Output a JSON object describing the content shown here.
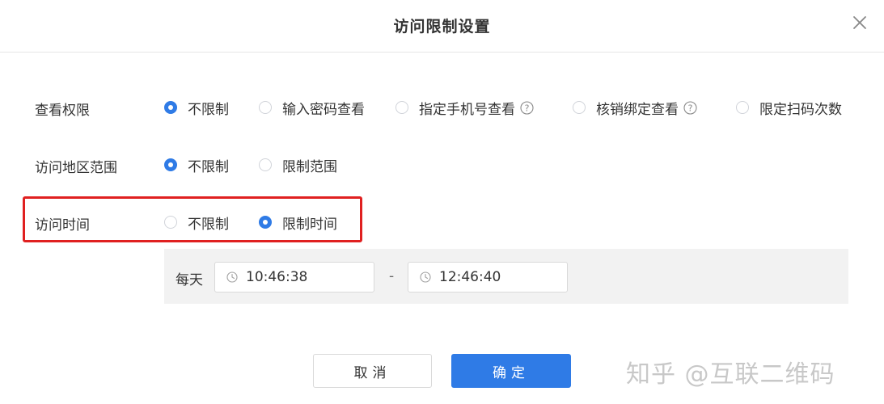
{
  "dialog": {
    "title": "访问限制设置"
  },
  "view_permission": {
    "label": "查看权限",
    "options": [
      {
        "label": "不限制",
        "checked": true
      },
      {
        "label": "输入密码查看",
        "checked": false
      },
      {
        "label": "指定手机号查看",
        "checked": false
      },
      {
        "label": "核销绑定查看",
        "checked": false
      },
      {
        "label": "限定扫码次数",
        "checked": false
      }
    ]
  },
  "region": {
    "label": "访问地区范围",
    "options": [
      {
        "label": "不限制",
        "checked": true
      },
      {
        "label": "限制范围",
        "checked": false
      }
    ]
  },
  "access_time": {
    "label": "访问时间",
    "options": [
      {
        "label": "不限制",
        "checked": false
      },
      {
        "label": "限制时间",
        "checked": true
      }
    ]
  },
  "time_range": {
    "period": "每天",
    "start": "10:46:38",
    "separator": "-",
    "end": "12:46:40"
  },
  "footer": {
    "cancel_label": "取消",
    "ok_label": "确定"
  },
  "watermark": "知乎 @互联二维码",
  "colors": {
    "primary": "#2f7be6",
    "highlight": "#e02020"
  },
  "icons": {
    "close": "close-icon",
    "help": "question-circle-icon",
    "clock": "clock-icon"
  }
}
